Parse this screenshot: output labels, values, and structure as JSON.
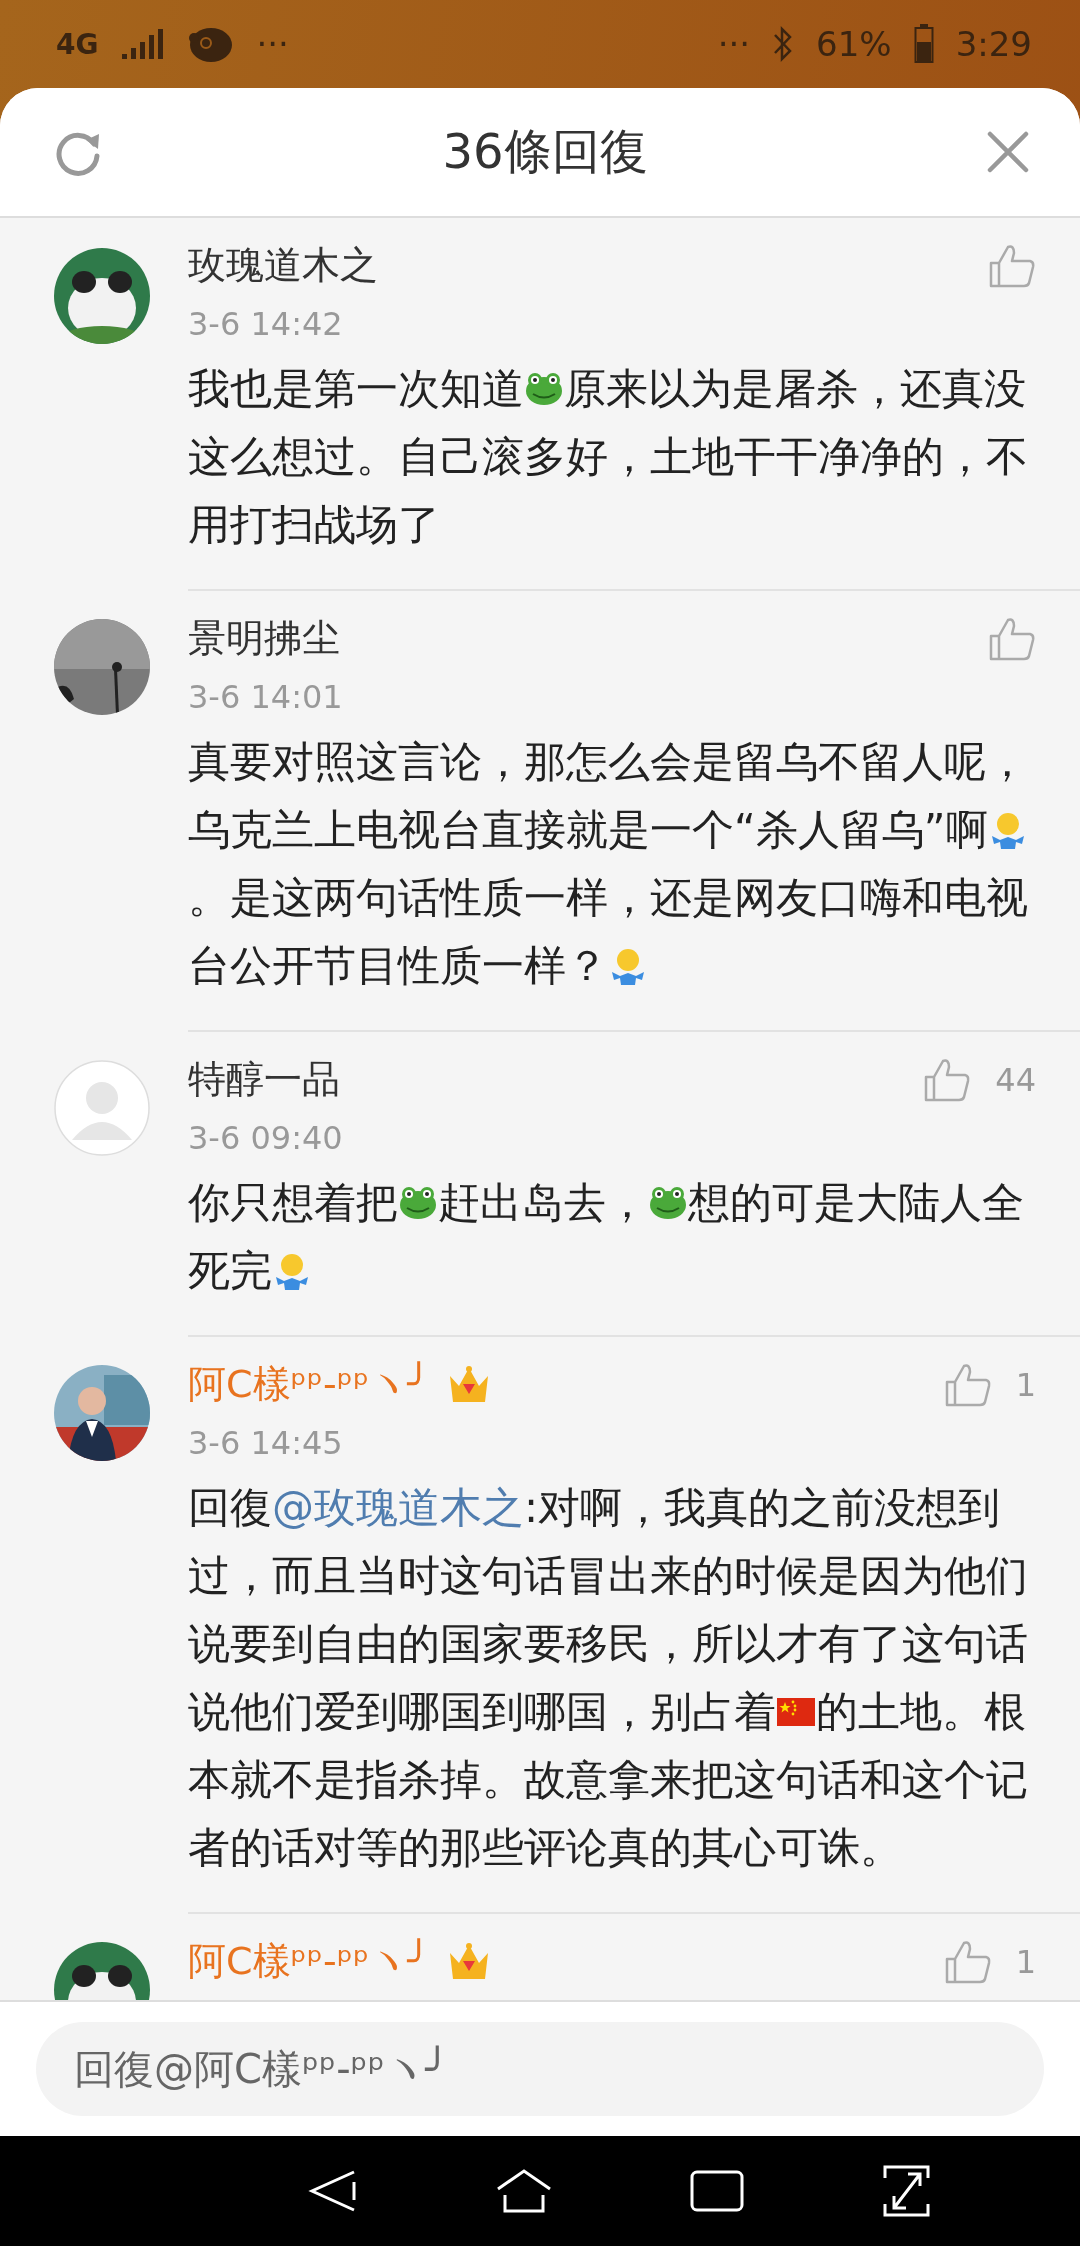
{
  "status_bar": {
    "network": "4G",
    "more_left": "···",
    "more_right": "···",
    "battery": "61%",
    "time": "3:29"
  },
  "header": {
    "title": "36條回復"
  },
  "comments": [
    {
      "author": "玫瑰道木之",
      "vip": false,
      "time": "3-6 14:42",
      "avatar": {
        "kind": "picture"
      },
      "segments": [
        {
          "kind": "text",
          "text": "我也是第一次知道"
        },
        {
          "kind": "frog"
        },
        {
          "kind": "text",
          "text": "原来以为是屠杀，还真没这么想过。自己滚多好，土地干干净净的，不用打扫战场了"
        }
      ]
    },
    {
      "author": "景明拂尘",
      "vip": false,
      "time": "3-6 14:01",
      "avatar": {
        "kind": "picture"
      },
      "segments": [
        {
          "kind": "text",
          "text": "真要对照这言论，那怎么会是留乌不留人呢，乌克兰上电视台直接就是一个“杀人留乌”啊"
        },
        {
          "kind": "shrug"
        },
        {
          "kind": "text",
          "text": "。是这两句话性质一样，还是网友口嗨和电视台公开节目性质一样？"
        },
        {
          "kind": "shrug"
        }
      ]
    },
    {
      "author": "特醇一品",
      "vip": false,
      "time": "3-6 09:40",
      "likes": "44",
      "avatar": {
        "kind": "default"
      },
      "segments": [
        {
          "kind": "text",
          "text": "你只想着把"
        },
        {
          "kind": "frog"
        },
        {
          "kind": "text",
          "text": "赶出岛去，"
        },
        {
          "kind": "frog"
        },
        {
          "kind": "text",
          "text": "想的可是大陆人全死完"
        },
        {
          "kind": "shrug"
        }
      ]
    },
    {
      "author": "阿C樣ᵖᵖ-ᵖᵖヽ╯",
      "vip": true,
      "time": "3-6 14:45",
      "likes": "1",
      "avatar": {
        "kind": "picture"
      },
      "segments": [
        {
          "kind": "text",
          "text": "回復"
        },
        {
          "kind": "mention",
          "text": "@玫瑰道木之"
        },
        {
          "kind": "text",
          "text": ":对啊，我真的之前没想到过，而且当时这句话冒出来的时候是因为他们说要到自由的国家要移民，所以才有了这句话说他们爱到哪国到哪国，别占着"
        },
        {
          "kind": "flag"
        },
        {
          "kind": "text",
          "text": "的土地。根本就不是指杀掉。故意拿来把这句话和这个记者的话对等的那些评论真的其心可诛。"
        }
      ]
    },
    {
      "author": "阿C樣ᵖᵖ-ᵖᵖヽ╯",
      "vip": true,
      "likes": "1",
      "avatar": {
        "kind": "picture"
      }
    }
  ],
  "reply_field": {
    "placeholder": "回復@阿C樣ᵖᵖ-ᵖᵖヽ╯"
  }
}
